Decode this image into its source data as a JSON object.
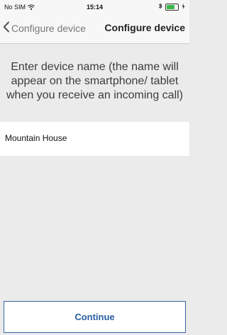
{
  "status_bar": {
    "carrier": "No SIM",
    "time": "15:14",
    "battery_level": 0.7,
    "colors": {
      "battery": "#3bb54a"
    }
  },
  "nav": {
    "back_label": "Configure device",
    "title": "Configure device"
  },
  "main": {
    "instruction": "Enter device name (the name will appear on the smartphone/ tablet when you receive an incoming call)",
    "device_name_value": "Mountain House"
  },
  "footer": {
    "continue_label": "Continue",
    "colors": {
      "accent": "#2a5d9f"
    }
  },
  "icons": {
    "wifi": "wifi-icon",
    "bluetooth": "bluetooth-icon",
    "battery": "battery-icon",
    "charging": "charging-icon",
    "back": "chevron-left-icon"
  }
}
